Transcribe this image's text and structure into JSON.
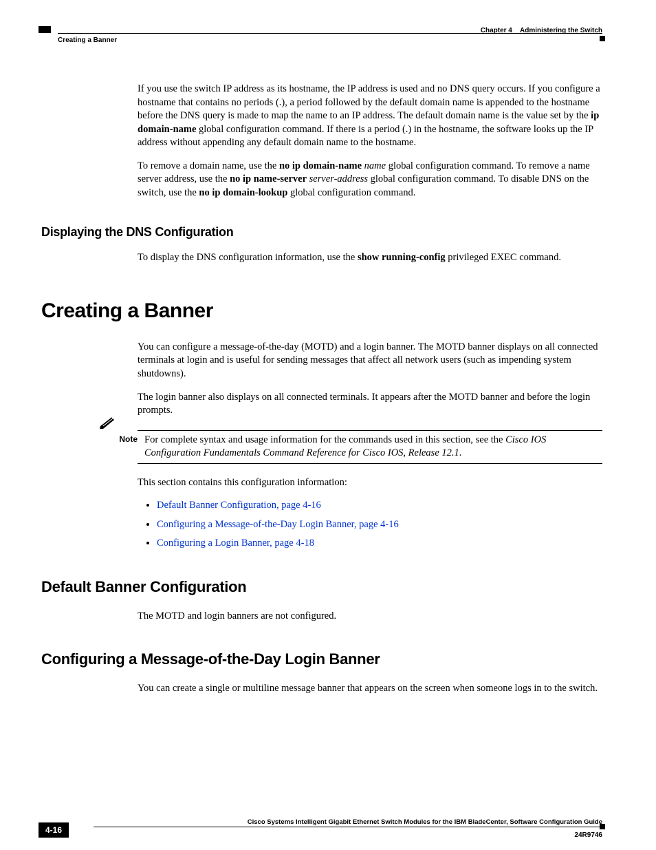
{
  "header": {
    "left": "Creating a Banner",
    "right_chapter": "Chapter 4",
    "right_title": "Administering the Switch"
  },
  "p1_a": "If you use the switch IP address as its hostname, the IP address is used and no DNS query occurs. If you configure a hostname that contains no periods (.), a period followed by the default domain name is appended to the hostname before the DNS query is made to map the name to an IP address. The default domain name is the value set by the ",
  "p1_b": "ip domain-name",
  "p1_c": " global configuration command. If there is a period (.) in the hostname, the software looks up the IP address without appending any default domain name to the hostname.",
  "p2_a": "To remove a domain name, use the ",
  "p2_b": "no ip domain-name",
  "p2_c": " ",
  "p2_d": "name",
  "p2_e": " global configuration command. To remove a name server address, use the ",
  "p2_f": "no ip name-server",
  "p2_g": " ",
  "p2_h": "server-address",
  "p2_i": " global configuration command. To disable DNS on the switch, use the ",
  "p2_j": "no ip domain-lookup",
  "p2_k": " global configuration command.",
  "h3_1": "Displaying the DNS Configuration",
  "p3_a": "To display the DNS configuration information, use the ",
  "p3_b": "show running-config",
  "p3_c": " privileged EXEC command.",
  "h1_1": "Creating a Banner",
  "p4": "You can configure a message-of-the-day (MOTD) and a login banner. The MOTD banner displays on all connected terminals at login and is useful for sending messages that affect all network users (such as impending system shutdowns).",
  "p5": "The login banner also displays on all connected terminals. It appears after the MOTD banner and before the login prompts.",
  "note_label": "Note",
  "note_a": "For complete syntax and usage information for the commands used in this section, see the ",
  "note_b": "Cisco IOS Configuration Fundamentals Command Reference for Cisco IOS, Release 12.1",
  "note_c": ".",
  "p6": "This section contains this configuration information:",
  "links": [
    "Default Banner Configuration, page 4-16",
    "Configuring a Message-of-the-Day Login Banner, page 4-16",
    "Configuring a Login Banner, page 4-18"
  ],
  "h2_1": "Default Banner Configuration",
  "p7": "The MOTD and login banners are not configured.",
  "h2_2": "Configuring a Message-of-the-Day Login Banner",
  "p8": "You can create a single or multiline message banner that appears on the screen when someone logs in to the switch.",
  "footer": {
    "title": "Cisco Systems Intelligent Gigabit Ethernet Switch Modules for the IBM BladeCenter, Software Configuration Guide",
    "page": "4-16",
    "docnum": "24R9746"
  }
}
